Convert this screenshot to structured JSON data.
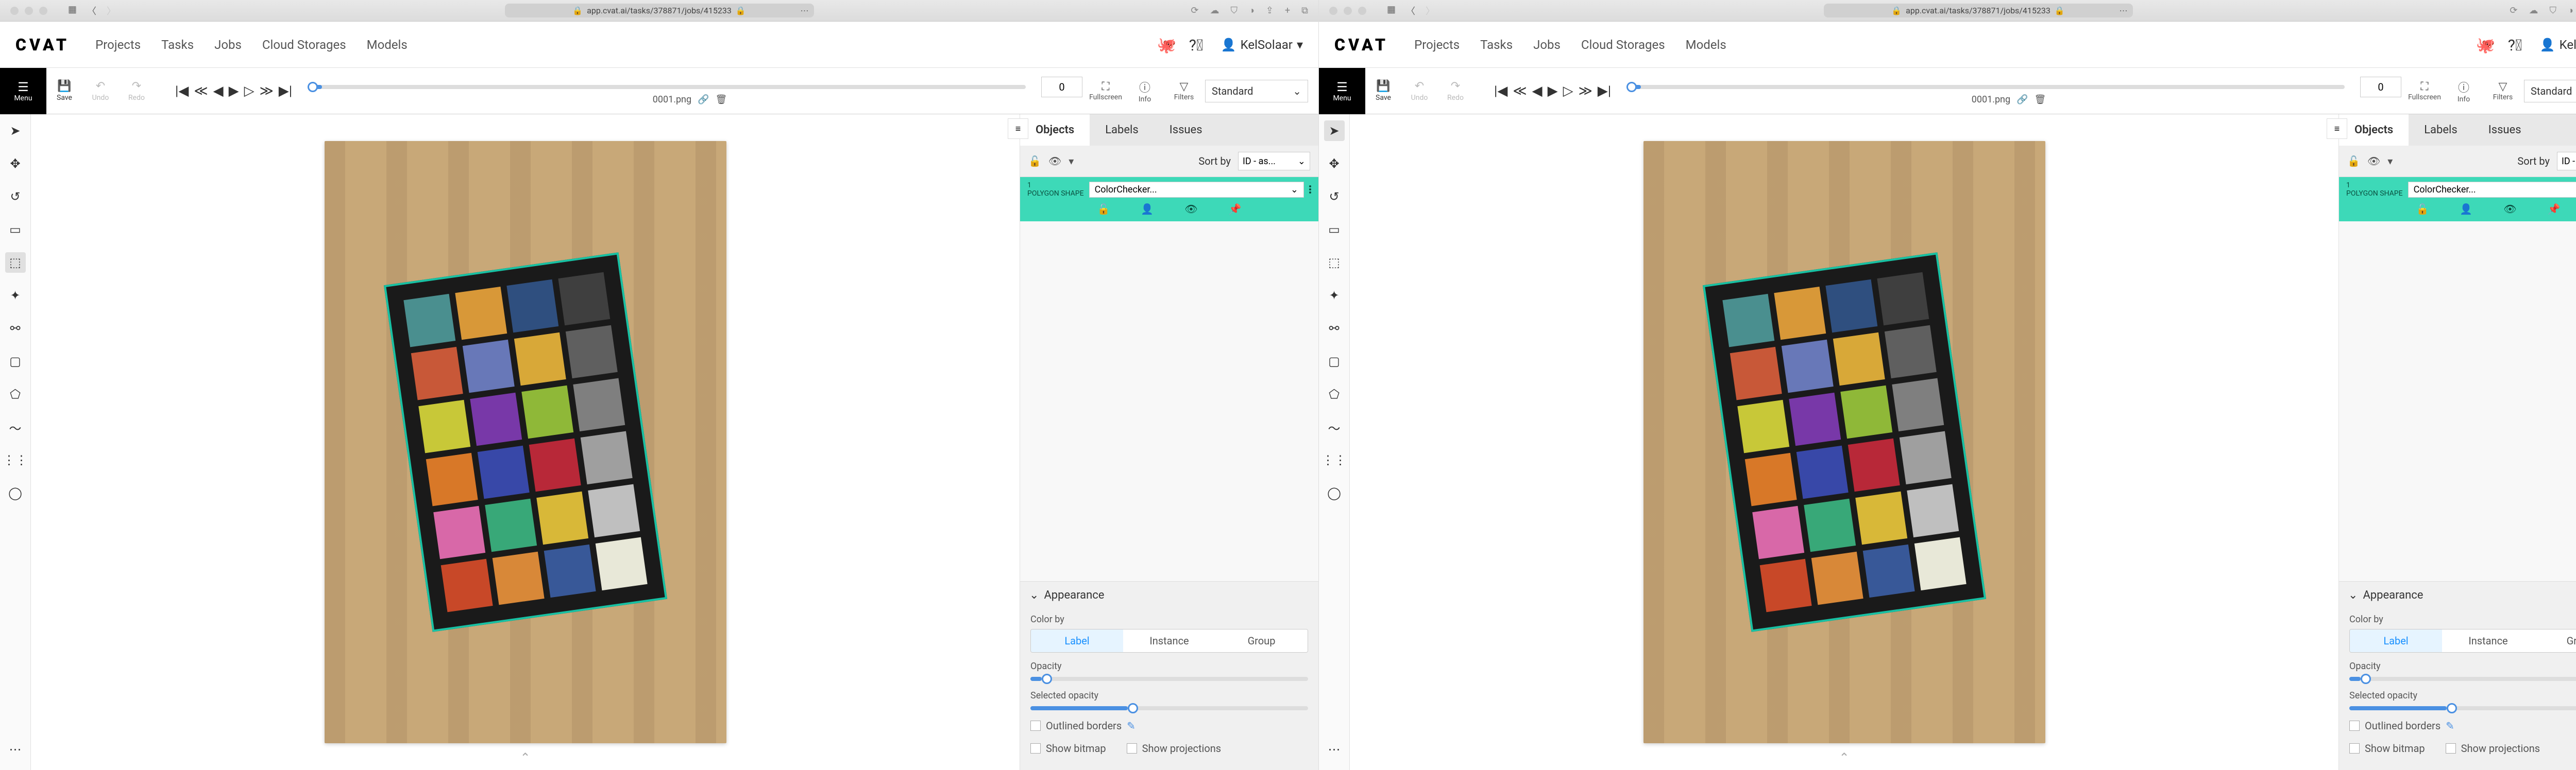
{
  "url": "app.cvat.ai/tasks/378871/jobs/415233",
  "logo": "CVAT",
  "nav": [
    "Projects",
    "Tasks",
    "Jobs",
    "Cloud Storages",
    "Models"
  ],
  "user": "KelSolaar",
  "menu_label": "Menu",
  "toolbar": {
    "save": "Save",
    "undo": "Undo",
    "redo": "Redo"
  },
  "frame": {
    "filename": "0001.png",
    "value": "0"
  },
  "view_opts": {
    "fullscreen": "Fullscreen",
    "info": "Info",
    "filters": "Filters"
  },
  "workspace": "Standard",
  "tabs": [
    "Objects",
    "Labels",
    "Issues"
  ],
  "sort_by": "Sort by",
  "sort_value": "ID - as...",
  "object": {
    "id": "1",
    "type": "POLYGON SHAPE",
    "label": "ColorChecker..."
  },
  "appearance": {
    "title": "Appearance",
    "color_by": "Color by",
    "options": [
      "Label",
      "Instance",
      "Group"
    ],
    "opacity": "Opacity",
    "selected_opacity": "Selected opacity",
    "outlined": "Outlined borders",
    "bitmap": "Show bitmap",
    "projections": "Show projections"
  },
  "swatches": [
    "#4a8f8f",
    "#d89838",
    "#2f4f7f",
    "#3f3f3f",
    "#c85838",
    "#6878b8",
    "#d8a838",
    "#5f5f5f",
    "#c8c838",
    "#7838a8",
    "#8fb838",
    "#7f7f7f",
    "#d87828",
    "#3848a8",
    "#b82838",
    "#9f9f9f",
    "#d868a8",
    "#38a878",
    "#d8b838",
    "#bfbfbf",
    "#c84828",
    "#d88838",
    "#385898",
    "#e8e8d8"
  ]
}
